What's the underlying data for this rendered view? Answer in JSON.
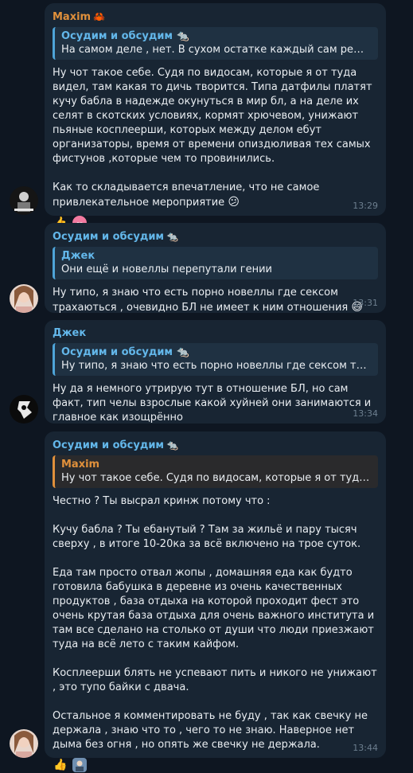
{
  "messages": [
    {
      "sender": "Maxim",
      "sender_emoji": "🦀",
      "reply": {
        "name": "Осудим и обсудим",
        "name_emoji": "🐀",
        "text": "На самом деле , нет. В сухом остатке каждый сам решает как ..."
      },
      "text": "Ну чот такое себе. Судя по видосам, которые я от туда видел, там какая то дичь творится. Типа датфилы платят кучу бабла в надежде окунуться в мир бл, а на деле их селят в скотских условиях, кормят хрючевом, унижают пьяные косплеерши, которых между делом ебут организаторы, время от времени опиздюливая тех самых фистунов ,которые чем то провинились.\n\nКак то складывается впечатление, что не самое привлекательное мероприятие",
      "text_emoji": "😕",
      "reactions": [
        "👍",
        "cc"
      ],
      "time": "13:29"
    },
    {
      "sender": "Осудим и обсудим",
      "sender_emoji": "🐀",
      "reply": {
        "name": "Джек",
        "text": "Они ещё и новеллы перепутали гении"
      },
      "text": "Ну типо, я знаю что есть порно новеллы где сексом трахаються , очевидно БЛ не имеет к ним отношения",
      "text_emoji": "😅",
      "time": "13:31"
    },
    {
      "sender": "Джек",
      "reply": {
        "name": "Осудим и обсудим",
        "name_emoji": "🐀",
        "text": "Ну типо, я знаю что есть порно новеллы где сексом трахают..."
      },
      "text": "Ну да я немного утрирую тут в отношение БЛ, но сам факт, тип челы взрослые какой хуйней они занимаются и главное как изощрённо",
      "time": "13:34"
    },
    {
      "sender": "Осудим и обсудим",
      "sender_emoji": "🐀",
      "reply": {
        "name": "Maxim",
        "text": "Ну чот такое себе. Судя по видосам, которые я от туда видел,..."
      },
      "text": "Честно ? Ты высрал кринж потому что :\n\nКучу бабла ? Ты ебанутый ? Там за жильё и пару тысяч сверху , в итоге 10-20ка за всё включено на трое суток.\n\nЕда там просто отвал жопы , домашняя еда как будто готовила бабушка в деревне из очень качественных продуктов , база отдыха на которой проходит фест это очень крутая база отдыха для очень важного института и там все сделано на столько от души что люди приезжают туда на всё лето с таким кайфом.\n\nКосплеерши блять не успевают пить и никого не унижают , это тупо байки с двача.\n\nОстальное я комментировать не буду , так как свечку не держала , знаю что то , чего то не знаю. Наверное нет дыма без огня , но опять же свечку не держала.",
      "reactions": [
        "👍",
        "avatar"
      ],
      "time": "13:44"
    }
  ]
}
